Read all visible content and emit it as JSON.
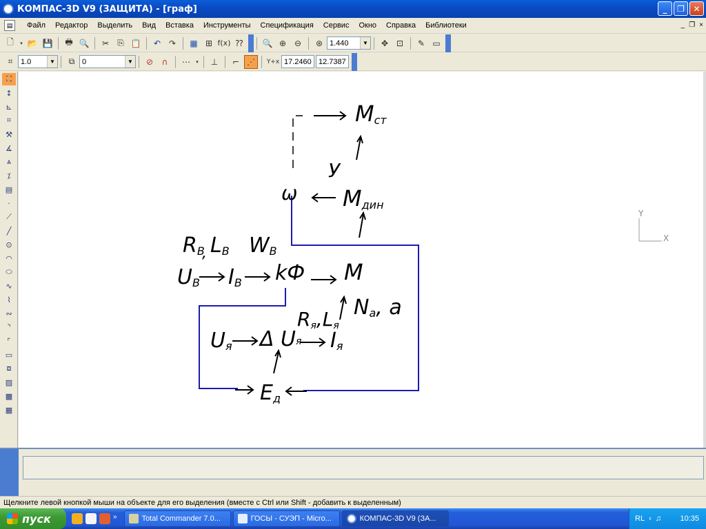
{
  "window": {
    "title": "КОМПАС-3D V9 (ЗАЩИТА) - [граф]",
    "buttons": {
      "minimize": "_",
      "maximize": "❐",
      "close": "✕"
    }
  },
  "menu": {
    "items": [
      "Файл",
      "Редактор",
      "Выделить",
      "Вид",
      "Вставка",
      "Инструменты",
      "Спецификация",
      "Сервис",
      "Окно",
      "Справка",
      "Библиотеки"
    ],
    "mdi": {
      "minimize": "_",
      "restore": "❐",
      "close": "×"
    }
  },
  "toolbar_standard": {
    "fx_label": "f(x)",
    "zoom_value": "1.440"
  },
  "toolbar_current": {
    "step_value": "1.0",
    "layer_value": "0",
    "coord_label": "Y+x",
    "coord_x": "17.2460",
    "coord_y": "12.7387"
  },
  "canvas": {
    "axis_y": "Y",
    "axis_x": "X",
    "labels": {
      "m_st_main": "M",
      "m_st_sub": "ст",
      "y": "У",
      "omega": "ω",
      "m_din_main": "M",
      "m_din_sub": "дин",
      "rb_lb": "R",
      "rb_sub": "В",
      "lb": "L",
      "lb_sub": "В",
      "comma1": ",",
      "wb": "W",
      "wb_sub": "В",
      "ub": "U",
      "ub_sub": "В",
      "ib": "I",
      "ib_sub": "В",
      "kf": "kФ",
      "m": "M",
      "n": "N",
      "n_sub": "a",
      "n_tail": ", a",
      "rya": "R",
      "rya_sub": "я",
      "lya": ",L",
      "lya_sub": "я",
      "uya": "U",
      "uya_sub": "я",
      "delta_u": "Δ U",
      "delta_sub": "я",
      "iya": "I",
      "iya_sub": "я",
      "ed": "E",
      "ed_sub": "д"
    }
  },
  "status": {
    "hint": "Щелкните левой кнопкой мыши на объекте для его выделения (вместе с Ctrl или Shift - добавить к выделенным)"
  },
  "taskbar": {
    "start": "пуск",
    "tasks": [
      "Total Commander 7.0...",
      "ГОСЫ - СУЭП - Micro...",
      "КОМПАС-3D V9 (ЗА..."
    ],
    "lang": "RL",
    "clock": "10:35"
  }
}
